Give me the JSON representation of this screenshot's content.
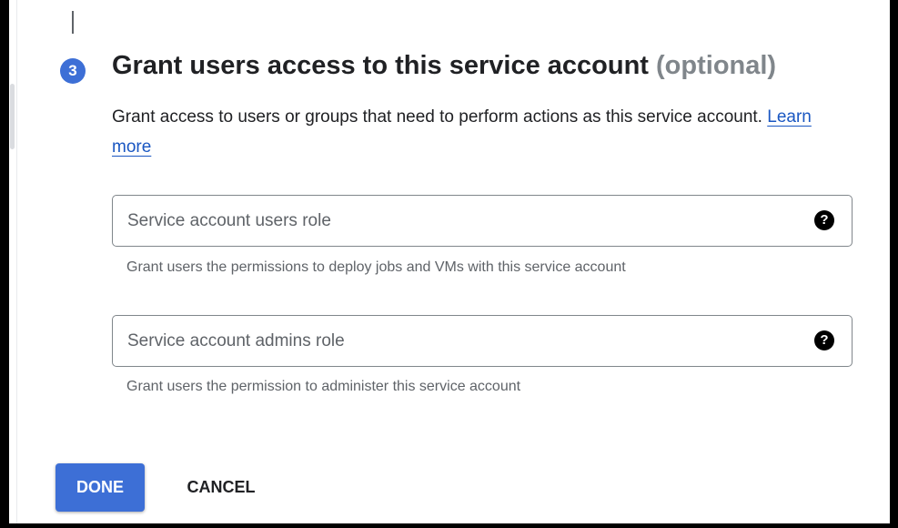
{
  "step": {
    "number": "3",
    "title": "Grant users access to this service account",
    "title_optional": "(optional)",
    "description": "Grant access to users or groups that need to perform actions as this service account.",
    "learn_more": "Learn more"
  },
  "fields": [
    {
      "label": "Service account users role",
      "hint": "Grant users the permissions to deploy jobs and VMs with this service account",
      "icon": "help-circle-icon"
    },
    {
      "label": "Service account admins role",
      "hint": "Grant users the permission to administer this service account",
      "icon": "help-circle-icon"
    }
  ],
  "actions": {
    "done": "DONE",
    "cancel": "CANCEL"
  },
  "colors": {
    "accent": "#3d6fd6",
    "link": "#1a57c2"
  }
}
